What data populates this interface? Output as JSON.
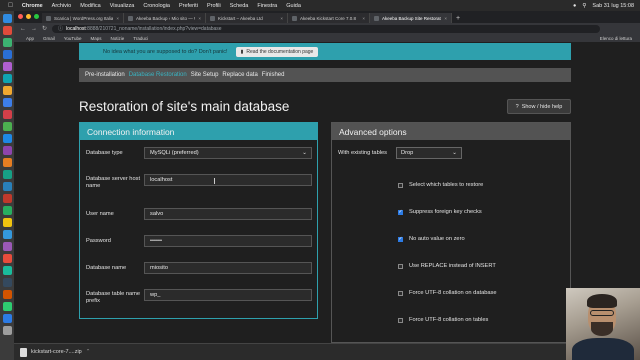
{
  "menubar": {
    "app": "Chrome",
    "menus": [
      "Archivio",
      "Modifica",
      "Visualizza",
      "Cronologia",
      "Preferiti",
      "Profili",
      "Scheda",
      "Finestra",
      "Guida"
    ],
    "clock": "Sab 31 lug  15:08"
  },
  "browser": {
    "tabs": [
      {
        "label": "Scarica | WordPress.org Italia"
      },
      {
        "label": "Akeeba Backup ‹ Mio sito — W"
      },
      {
        "label": "Kickstart – Akeeba Ltd"
      },
      {
        "label": "Akeeba Kickstart Core 7.0.8"
      },
      {
        "label": "Akeeba Backup Site Restorat..."
      }
    ],
    "url_host": "localhost",
    "url_path": ":8888/210721_noname/installation/index.php?view=database",
    "bookmarks": [
      "App",
      "Gmail",
      "YouTube",
      "Maps",
      "Notizie",
      "Traduci"
    ],
    "reading_list": "Elenco di lettura"
  },
  "notice": {
    "text": "No idea what you are supposed to do? Don't panic!",
    "button": "Read the documentation page"
  },
  "crumbs": [
    {
      "label": "Pre-installation",
      "current": false
    },
    {
      "label": "Database Restoration",
      "current": true
    },
    {
      "label": "Site Setup",
      "current": false
    },
    {
      "label": "Replace data",
      "current": false
    },
    {
      "label": "Finished",
      "current": false
    }
  ],
  "page_title": "Restoration of site's main database",
  "help_button": "Show / hide help",
  "connection": {
    "title": "Connection information",
    "db_type_label": "Database type",
    "db_type_value": "MySQLi (preferred)",
    "host_label": "Database server host name",
    "host_value": "localhost",
    "user_label": "User name",
    "user_value": "salvo",
    "password_label": "Password",
    "password_value": "••••••",
    "dbname_label": "Database name",
    "dbname_value": "miosito",
    "prefix_label": "Database table name prefix",
    "prefix_value": "wp_"
  },
  "advanced": {
    "title": "Advanced options",
    "existing_label": "With existing tables",
    "existing_value": "Drop",
    "options": [
      {
        "label": "Select which tables to restore",
        "checked": false
      },
      {
        "label": "Suppress foreign key checks",
        "checked": true
      },
      {
        "label": "No auto value on zero",
        "checked": true
      },
      {
        "label": "Use REPLACE instead of INSERT",
        "checked": false
      },
      {
        "label": "Force UTF-8 collation on database",
        "checked": false
      },
      {
        "label": "Force UTF-8 collation on tables",
        "checked": false
      }
    ]
  },
  "download": {
    "filename": "kickstart-core-7....zip"
  },
  "colors": {
    "accent": "#2ea0ad",
    "panel_header_gray": "#535353",
    "checkbox_on": "#2c7be5"
  }
}
